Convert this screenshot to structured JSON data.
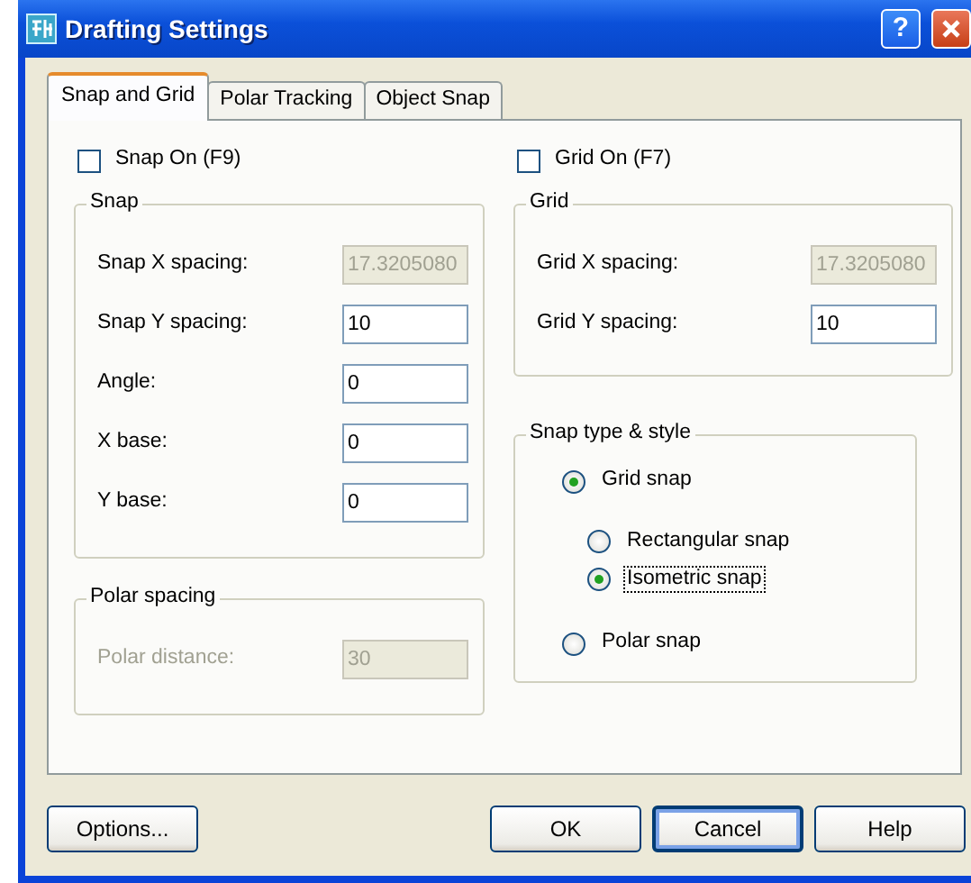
{
  "window": {
    "title": "Drafting Settings",
    "help_button": "?"
  },
  "tabs": [
    {
      "label": "Snap and Grid",
      "selected": true
    },
    {
      "label": "Polar Tracking",
      "selected": false
    },
    {
      "label": "Object Snap",
      "selected": false
    }
  ],
  "snap_on": {
    "label": "Snap On (F9)",
    "checked": false
  },
  "snap_group": {
    "title": "Snap",
    "disabled": false,
    "fields": [
      {
        "label": "Snap X spacing:",
        "value": "17.3205080",
        "disabled": true
      },
      {
        "label": "Snap Y spacing:",
        "value": "10",
        "disabled": false
      },
      {
        "label": "Angle:",
        "value": "0",
        "disabled": false
      },
      {
        "label": "X base:",
        "value": "0",
        "disabled": false
      },
      {
        "label": "Y base:",
        "value": "0",
        "disabled": false
      }
    ]
  },
  "polar_group": {
    "title": "Polar spacing",
    "disabled": true,
    "fields": [
      {
        "label": "Polar distance:",
        "value": "30",
        "disabled": true
      }
    ]
  },
  "grid_on": {
    "label": "Grid On (F7)",
    "checked": false
  },
  "grid_group": {
    "title": "Grid",
    "disabled": false,
    "fields": [
      {
        "label": "Grid X spacing:",
        "value": "17.3205080",
        "disabled": true
      },
      {
        "label": "Grid Y spacing:",
        "value": "10",
        "disabled": false
      }
    ]
  },
  "snap_type": {
    "title": "Snap type & style",
    "options": [
      {
        "label": "Grid snap",
        "selected": true,
        "focused": false,
        "children": [
          {
            "label": "Rectangular snap",
            "selected": false,
            "focused": false
          },
          {
            "label": "Isometric snap",
            "selected": true,
            "focused": true
          }
        ]
      },
      {
        "label": "Polar snap",
        "selected": false,
        "focused": false
      }
    ]
  },
  "buttons": [
    {
      "label": "Options...",
      "default": false
    },
    {
      "label": "OK",
      "default": false
    },
    {
      "label": "Cancel",
      "default": true
    },
    {
      "label": "Help",
      "default": false
    }
  ]
}
